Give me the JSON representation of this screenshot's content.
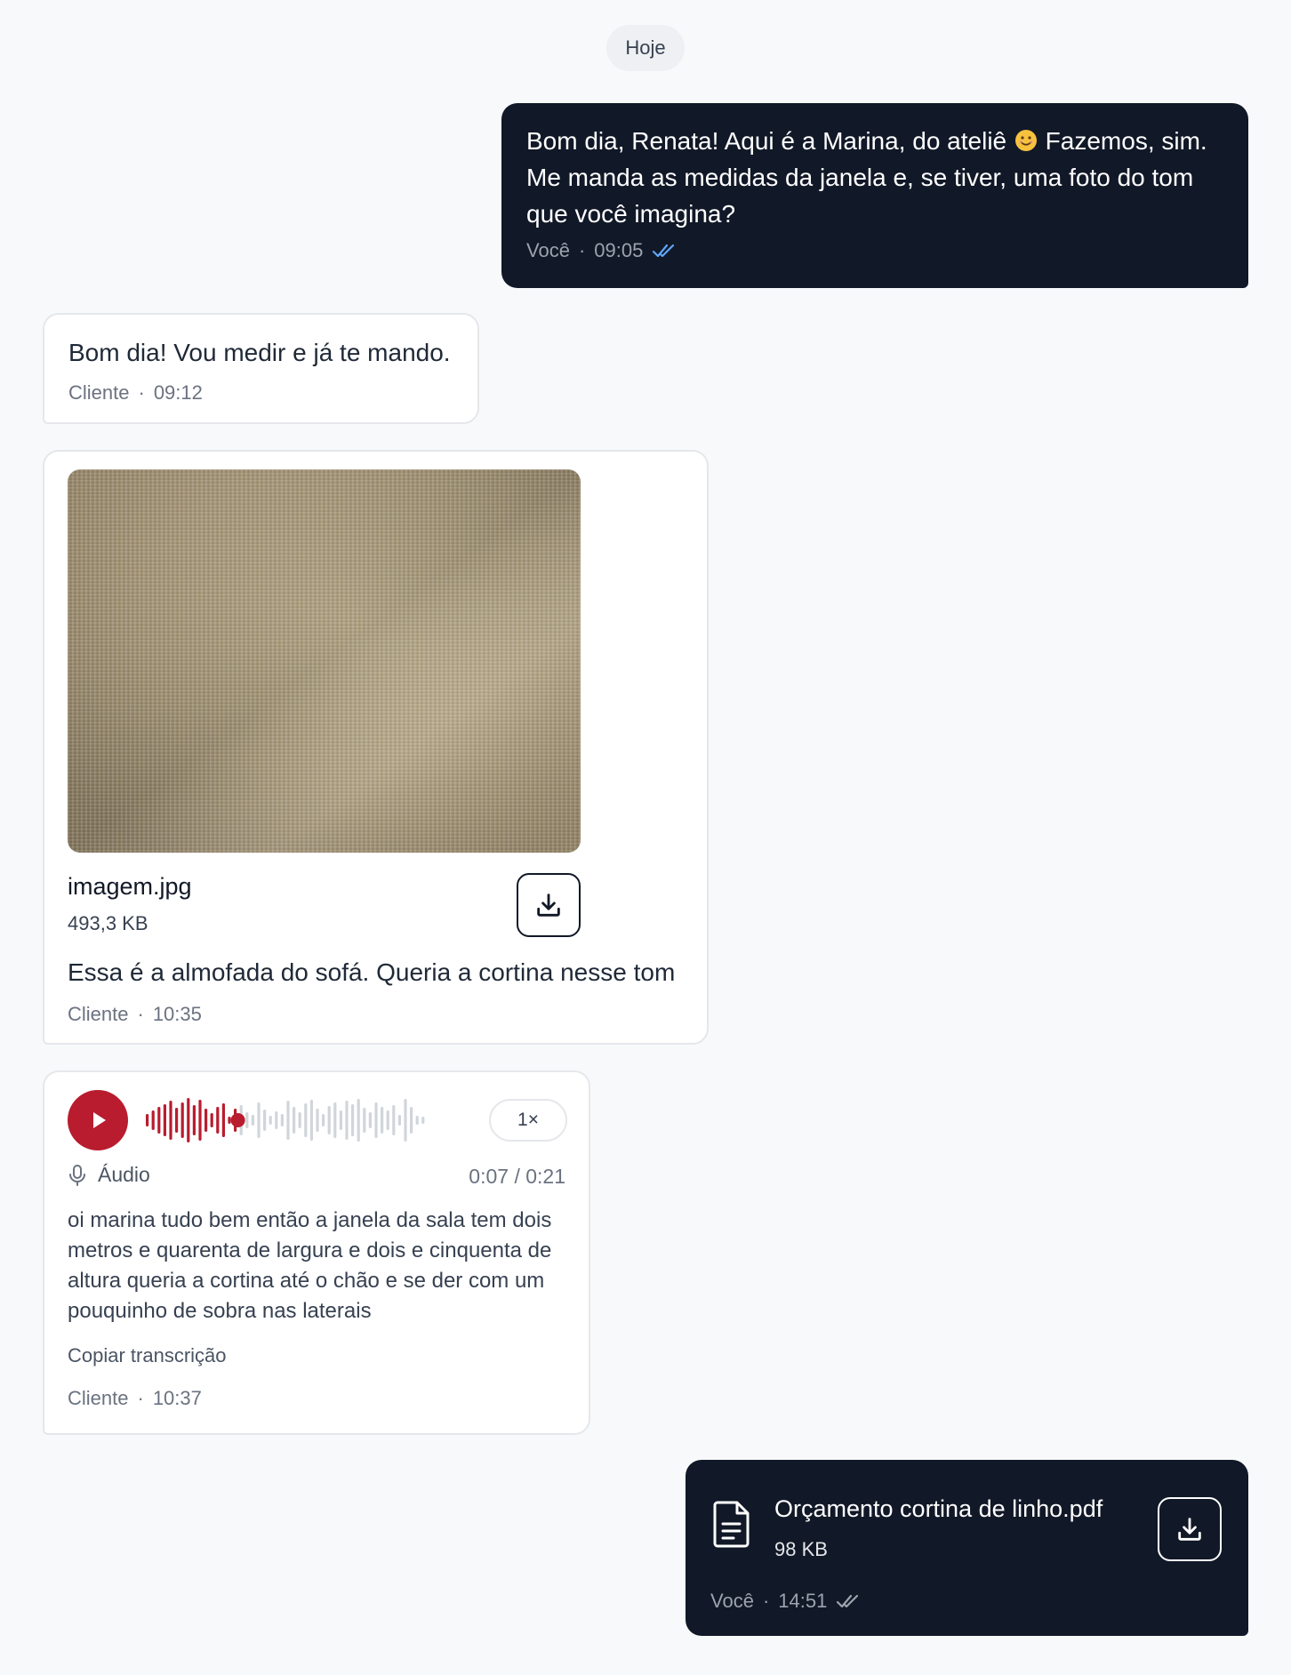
{
  "day_separator": "Hoje",
  "messages": {
    "m1": {
      "text_before_emoji": "Bom dia, Renata! Aqui é a Marina, do ateliê",
      "emoji": "smiling-face-emoji",
      "text_after_emoji": " Fazemos, sim. Me manda as medidas da janela e, se tiver, uma foto do tom que você imagina?",
      "sender": "Você",
      "time": "09:05",
      "status": "read"
    },
    "m2": {
      "text": "Bom dia! Vou medir e já te mando.",
      "sender": "Cliente",
      "time": "09:12"
    },
    "m3": {
      "file_name": "imagem.jpg",
      "file_size": "493,3 KB",
      "caption": "Essa é a almofada do sofá. Queria a cortina nesse tom",
      "sender": "Cliente",
      "time": "10:35"
    },
    "m4": {
      "speed": "1×",
      "label": "Áudio",
      "time_display": "0:07 / 0:21",
      "progress": 0.33,
      "transcript": "oi marina tudo bem então a janela da sala tem dois metros e quarenta de largura e dois e cinquenta de altura queria a cortina até o chão e se der com um pouquinho de sobra nas laterais",
      "copy_label": "Copiar transcrição",
      "sender": "Cliente",
      "time": "10:37"
    },
    "m5": {
      "file_name": "Orçamento cortina de linho.pdf",
      "file_size": "98 KB",
      "sender": "Você",
      "time": "14:51",
      "status": "delivered"
    }
  },
  "colors": {
    "outgoing_bg": "#111827",
    "read_tick": "#60a5fa",
    "audio_accent": "#b91c2e",
    "wave_inactive": "#d1d5db"
  },
  "icons": [
    "download-icon",
    "play-icon",
    "mic-icon",
    "document-icon",
    "double-check-icon"
  ]
}
